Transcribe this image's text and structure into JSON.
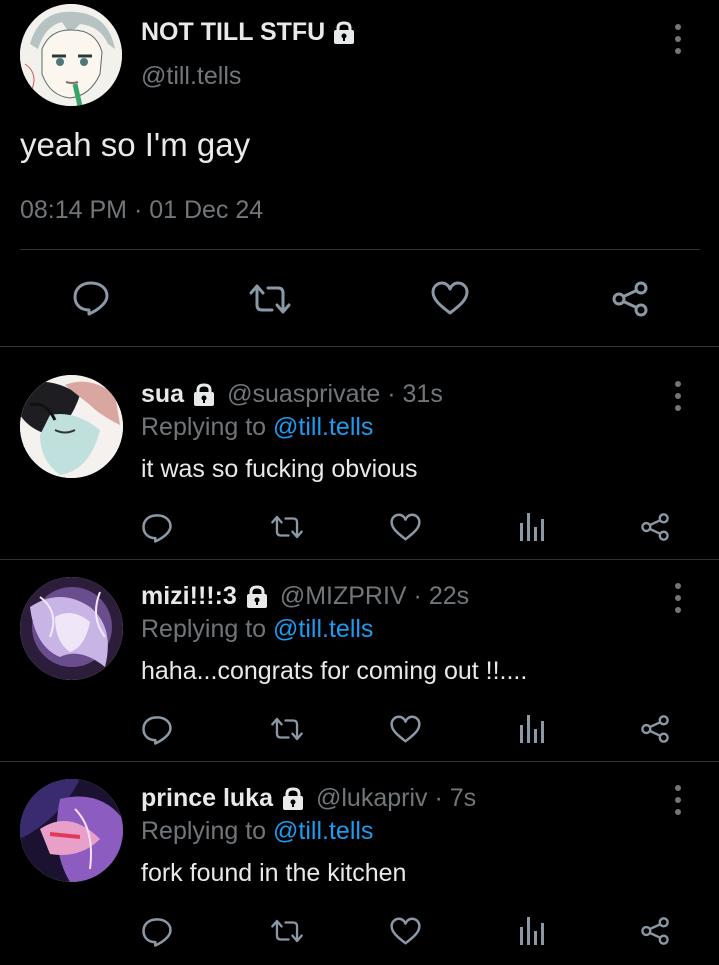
{
  "main_tweet": {
    "display_name": "NOT TILL STFU",
    "handle": "@till.tells",
    "text": "yeah so I'm gay",
    "timestamp": "08:14 PM · 01 Dec 24",
    "protected_icon": "lock-icon",
    "actions": [
      "reply-icon",
      "retweet-icon",
      "like-icon",
      "share-icon"
    ]
  },
  "replies": [
    {
      "display_name": "sua",
      "handle": "@suasprivate · 31s",
      "replying_prefix": "Replying to ",
      "replying_to": "@till.tells",
      "text": "it was so fucking obvious"
    },
    {
      "display_name": "mizi!!!:3",
      "handle": "@MIZPRIV · 22s",
      "replying_prefix": "Replying to ",
      "replying_to": "@till.tells",
      "text": "haha...congrats for coming out !!...."
    },
    {
      "display_name": "prince luka",
      "handle": "@lukapriv · 7s",
      "replying_prefix": "Replying to ",
      "replying_to": "@till.tells",
      "text": "fork found in the kitchen"
    }
  ],
  "colors": {
    "background": "#000000",
    "text_primary": "#e7e9ea",
    "text_secondary": "#71767b",
    "mention": "#1d9bf0",
    "divider": "#2f3336"
  }
}
